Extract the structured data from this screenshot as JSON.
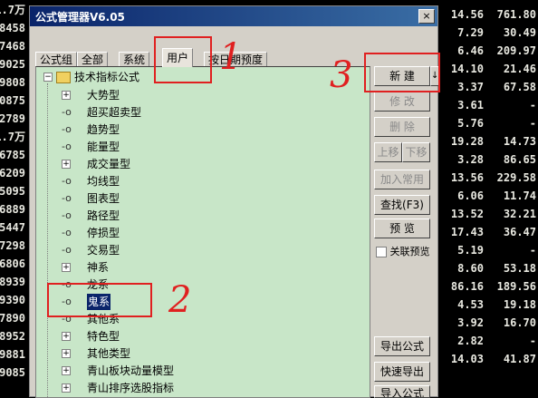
{
  "left_quotes": [
    "1.7万",
    "8458",
    "7468",
    "9025",
    "9808",
    "0875",
    "2789",
    "1.7万",
    "6785",
    "6209",
    "5095",
    "6889",
    "5447",
    "7298",
    "6806",
    "8939",
    "9390",
    "7890",
    "8952",
    "9881",
    "9085"
  ],
  "right_quotes": [
    {
      "a": "14.56",
      "b": "761.80",
      "ca": "w",
      "cb": "w"
    },
    {
      "a": "7.29",
      "b": "30.49",
      "ca": "w",
      "cb": "w"
    },
    {
      "a": "6.46",
      "b": "209.97",
      "ca": "w",
      "cb": "w"
    },
    {
      "a": "14.10",
      "b": "21.46",
      "ca": "w",
      "cb": "w"
    },
    {
      "a": "3.37",
      "b": "67.58",
      "ca": "w",
      "cb": "w"
    },
    {
      "a": "3.61",
      "b": "-",
      "ca": "w",
      "cb": "w"
    },
    {
      "a": "5.76",
      "b": "-",
      "ca": "w",
      "cb": "w"
    },
    {
      "a": "19.28",
      "b": "14.73",
      "ca": "w",
      "cb": "w"
    },
    {
      "a": "3.28",
      "b": "86.65",
      "ca": "w",
      "cb": "w"
    },
    {
      "a": "13.56",
      "b": "229.58",
      "ca": "w",
      "cb": "w"
    },
    {
      "a": "6.06",
      "b": "11.74",
      "ca": "w",
      "cb": "w"
    },
    {
      "a": "13.52",
      "b": "32.21",
      "ca": "w",
      "cb": "w"
    },
    {
      "a": "17.43",
      "b": "36.47",
      "ca": "w",
      "cb": "w"
    },
    {
      "a": "5.19",
      "b": "-",
      "ca": "w",
      "cb": "w"
    },
    {
      "a": "8.60",
      "b": "53.18",
      "ca": "w",
      "cb": "w"
    },
    {
      "a": "86.16",
      "b": "189.56",
      "ca": "w",
      "cb": "w"
    },
    {
      "a": "4.53",
      "b": "19.18",
      "ca": "w",
      "cb": "w"
    },
    {
      "a": "3.92",
      "b": "16.70",
      "ca": "w",
      "cb": "w"
    },
    {
      "a": "2.82",
      "b": "-",
      "ca": "w",
      "cb": "w"
    },
    {
      "a": "14.03",
      "b": "41.87",
      "ca": "w",
      "cb": "w"
    },
    {
      "a": "",
      "b": "",
      "ca": "w",
      "cb": "w"
    }
  ],
  "window": {
    "title": "公式管理器V6.05",
    "close": "×"
  },
  "tabs": [
    "公式组",
    "全部",
    "系统",
    "用户",
    "按日期预度"
  ],
  "tree": {
    "root": "技术指标公式",
    "items": [
      {
        "label": "大势型",
        "exp": true
      },
      {
        "label": "超买超卖型",
        "exp": false
      },
      {
        "label": "趋势型",
        "exp": false
      },
      {
        "label": "能量型",
        "exp": false
      },
      {
        "label": "成交量型",
        "exp": true
      },
      {
        "label": "均线型",
        "exp": false
      },
      {
        "label": "图表型",
        "exp": false
      },
      {
        "label": "路径型",
        "exp": false
      },
      {
        "label": "停损型",
        "exp": false
      },
      {
        "label": "交易型",
        "exp": false
      },
      {
        "label": "神系",
        "exp": true
      },
      {
        "label": "龙系",
        "exp": false
      },
      {
        "label": "鬼系",
        "exp": false,
        "selected": true
      },
      {
        "label": "其他系",
        "exp": false
      },
      {
        "label": "特色型",
        "exp": true
      },
      {
        "label": "其他类型",
        "exp": true
      },
      {
        "label": "青山板块动量模型",
        "exp": true
      },
      {
        "label": "青山排序选股指标",
        "exp": true
      }
    ]
  },
  "buttons": {
    "new": "新  建",
    "import_arrow": "↓",
    "modify": "修  改",
    "delete": "删  除",
    "move_up": "上移",
    "move_down": "下移",
    "add_common": "加入常用",
    "find": "查找(F3)",
    "preview": "预  览",
    "linked_preview": "关联预览",
    "export": "导出公式",
    "quick_export": "快速导出",
    "import": "导入公式"
  },
  "annotations": {
    "n1": "1",
    "n2": "2",
    "n3": "3"
  }
}
